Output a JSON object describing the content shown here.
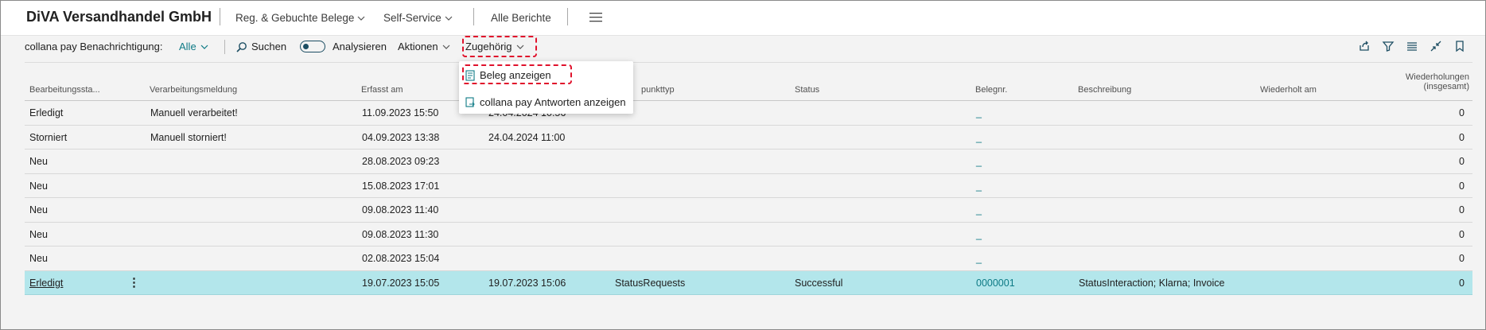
{
  "header": {
    "company": "DiVA Versandhandel GmbH",
    "nav": [
      {
        "label": "Reg. & Gebuchte Belege"
      },
      {
        "label": "Self-Service"
      },
      {
        "label": "Alle Berichte"
      }
    ]
  },
  "actionbar": {
    "filter_label": "collana pay Benachrichtigung:",
    "filter_value": "Alle",
    "search_label": "Suchen",
    "analyze_label": "Analysieren",
    "actions_label": "Aktionen",
    "related_label": "Zugehörig"
  },
  "dropdown": {
    "items": [
      {
        "label": "Beleg anzeigen"
      },
      {
        "label": "collana pay Antworten anzeigen"
      }
    ]
  },
  "table": {
    "headers": {
      "status_processing": "Bearbeitungssta...",
      "message": "Verarbeitungsmeldung",
      "captured": "Erfasst am",
      "endpoint": "punkttyp",
      "status": "Status",
      "docno": "Belegnr.",
      "description": "Beschreibung",
      "repeated": "Wiederholt am",
      "repeats_1": "Wiederholungen",
      "repeats_2": "(insgesamt)"
    },
    "rows": [
      {
        "proc": "Erledigt",
        "msg": "Manuell verarbeitet!",
        "captured": "11.09.2023 15:50",
        "proc_at": "24.04.2024 10:56",
        "type": "",
        "status": "",
        "docno": "_",
        "desc": "",
        "repeated": "",
        "count": "0"
      },
      {
        "proc": "Storniert",
        "msg": "Manuell storniert!",
        "captured": "04.09.2023 13:38",
        "proc_at": "24.04.2024 11:00",
        "type": "",
        "status": "",
        "docno": "_",
        "desc": "",
        "repeated": "",
        "count": "0"
      },
      {
        "proc": "Neu",
        "msg": "",
        "captured": "28.08.2023 09:23",
        "proc_at": "",
        "type": "",
        "status": "",
        "docno": "_",
        "desc": "",
        "repeated": "",
        "count": "0"
      },
      {
        "proc": "Neu",
        "msg": "",
        "captured": "15.08.2023 17:01",
        "proc_at": "",
        "type": "",
        "status": "",
        "docno": "_",
        "desc": "",
        "repeated": "",
        "count": "0"
      },
      {
        "proc": "Neu",
        "msg": "",
        "captured": "09.08.2023 11:40",
        "proc_at": "",
        "type": "",
        "status": "",
        "docno": "_",
        "desc": "",
        "repeated": "",
        "count": "0"
      },
      {
        "proc": "Neu",
        "msg": "",
        "captured": "09.08.2023 11:30",
        "proc_at": "",
        "type": "",
        "status": "",
        "docno": "_",
        "desc": "",
        "repeated": "",
        "count": "0"
      },
      {
        "proc": "Neu",
        "msg": "",
        "captured": "02.08.2023 15:04",
        "proc_at": "",
        "type": "",
        "status": "",
        "docno": "_",
        "desc": "",
        "repeated": "",
        "count": "0"
      },
      {
        "proc": "Erledigt",
        "msg": "",
        "captured": "19.07.2023 15:05",
        "proc_at": "19.07.2023 15:06",
        "type": "StatusRequests",
        "status": "Successful",
        "docno": "0000001",
        "desc": "StatusInteraction;  Klarna; Invoice",
        "repeated": "",
        "count": "0"
      }
    ]
  },
  "colors": {
    "accent": "#0d7a85",
    "selected_row": "#b3e6eb",
    "highlight": "#e0112b"
  }
}
